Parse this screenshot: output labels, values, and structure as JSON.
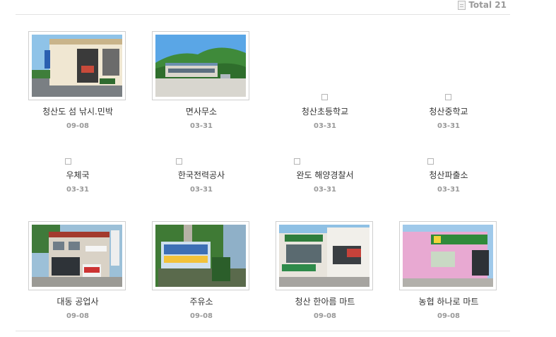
{
  "header": {
    "total_label": "Total 21"
  },
  "items": [
    {
      "title": "청산도 섬 낚시.민박",
      "date": "09-08",
      "thumb": "image"
    },
    {
      "title": "면사무소",
      "date": "03-31",
      "thumb": "image"
    },
    {
      "title": "청산초등학교",
      "date": "03-31",
      "thumb": "broken"
    },
    {
      "title": "청산중학교",
      "date": "03-31",
      "thumb": "broken"
    },
    {
      "title": "우체국",
      "date": "03-31",
      "thumb": "broken"
    },
    {
      "title": "한국전력공사",
      "date": "03-31",
      "thumb": "broken"
    },
    {
      "title": "완도 해양경찰서",
      "date": "03-31",
      "thumb": "broken"
    },
    {
      "title": "청산파출소",
      "date": "03-31",
      "thumb": "broken"
    },
    {
      "title": "대동 공업사",
      "date": "09-08",
      "thumb": "image"
    },
    {
      "title": "주유소",
      "date": "09-08",
      "thumb": "image"
    },
    {
      "title": "청산 한아름 마트",
      "date": "09-08",
      "thumb": "image"
    },
    {
      "title": "농협 하나로 마트",
      "date": "09-08",
      "thumb": "image"
    }
  ]
}
